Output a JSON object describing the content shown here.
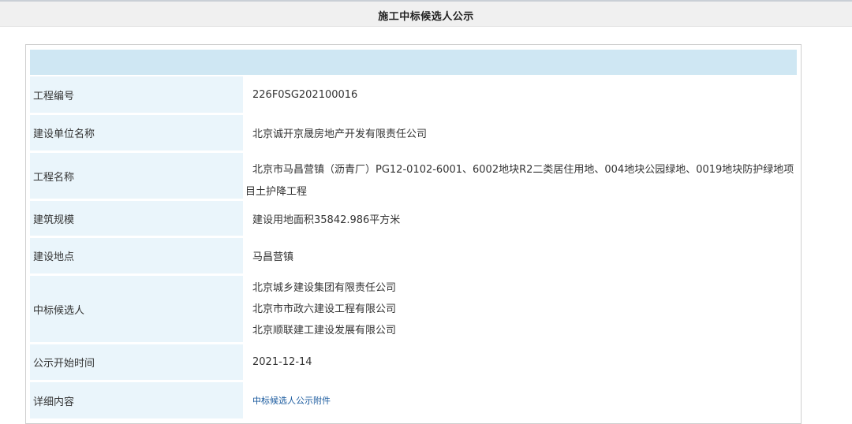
{
  "page": {
    "title": "施工中标候选人公示"
  },
  "rows": {
    "project_no": {
      "label": "工程编号",
      "value": "226F0SG202100016"
    },
    "builder": {
      "label": "建设单位名称",
      "value": "北京诚开京晟房地产开发有限责任公司"
    },
    "project_name": {
      "label": "工程名称",
      "value": "北京市马昌营镇（沥青厂）PG12-0102-6001、6002地块R2二类居住用地、004地块公园绿地、0019地块防护绿地项目土护降工程"
    },
    "scale": {
      "label": "建筑规模",
      "value": "建设用地面积35842.986平方米"
    },
    "location": {
      "label": "建设地点",
      "value": "马昌营镇"
    },
    "candidates": {
      "label": "中标候选人",
      "values": [
        "北京城乡建设集团有限责任公司",
        "北京市市政六建设工程有限公司",
        "北京顺联建工建设发展有限公司"
      ]
    },
    "start_date": {
      "label": "公示开始时间",
      "value": "2021-12-14"
    },
    "details": {
      "label": "详细内容",
      "link": "中标候选人公示附件"
    }
  }
}
